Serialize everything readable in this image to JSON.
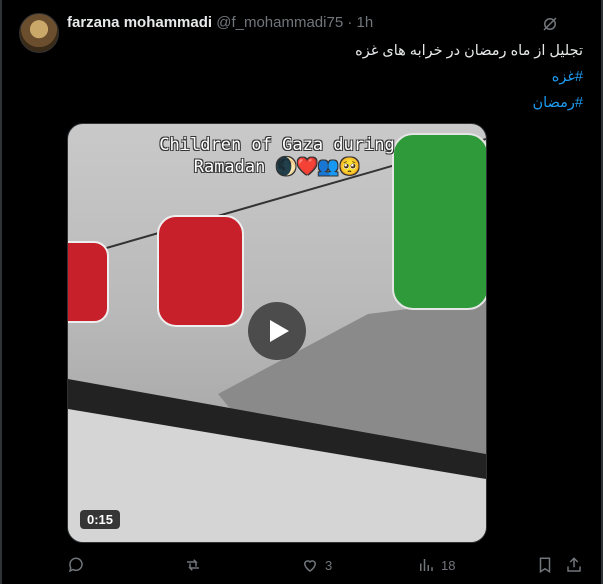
{
  "post": {
    "author_name": "farzana mohammadi",
    "handle": "@f_mohammadi75",
    "separator": "·",
    "time": "1h",
    "text": "تجلیل از ماه رمضان در خرابه های غزه",
    "hashtags": [
      "#غزه",
      "#رمضان"
    ]
  },
  "video": {
    "caption_line1": "Children of Gaza during",
    "caption_line2": "Ramadan 🌒❤️👥🥺",
    "duration": "0:15"
  },
  "actions": {
    "reply_count": "",
    "repost_count": "",
    "like_count": "3",
    "views_count": "18"
  }
}
